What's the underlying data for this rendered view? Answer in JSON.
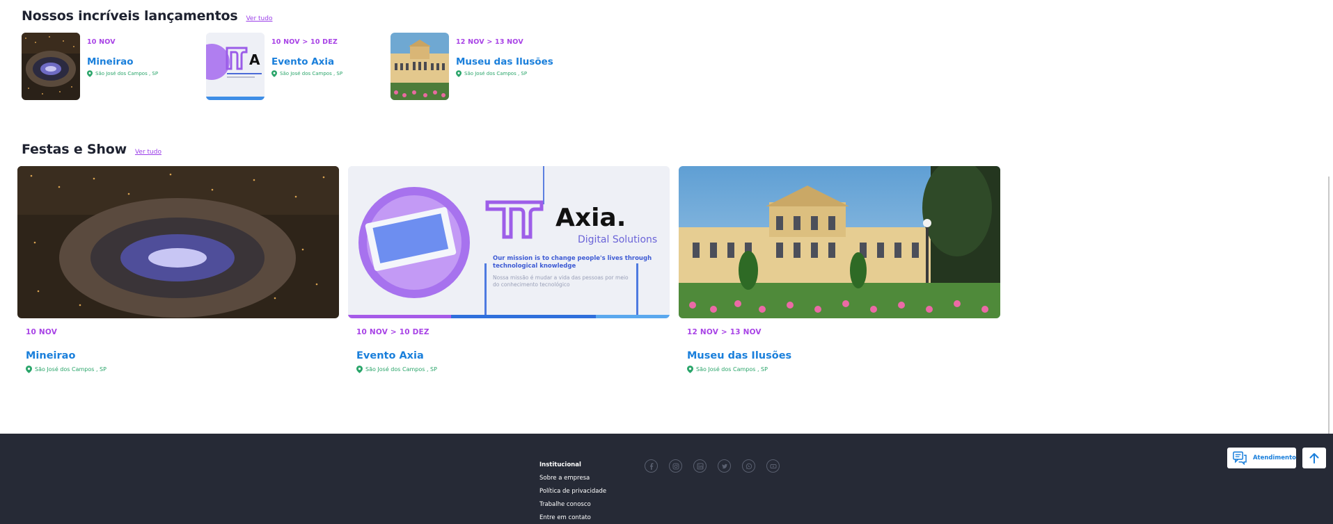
{
  "launches": {
    "title": "Nossos incríveis lançamentos",
    "see_all": "Ver tudo",
    "items": [
      {
        "date": "10 NOV",
        "name": "Mineirao",
        "location": "São José dos Campos , SP"
      },
      {
        "date": "10 NOV > 10 DEZ",
        "name": "Evento Axia",
        "location": "São José dos Campos , SP"
      },
      {
        "date": "12 NOV > 13 NOV",
        "name": "Museu das Ilusões",
        "location": "São José dos Campos , SP"
      }
    ]
  },
  "parties": {
    "title": "Festas e Show",
    "see_all": "Ver tudo",
    "items": [
      {
        "date": "10 NOV",
        "name": "Mineirao",
        "location": "São José dos Campos , SP"
      },
      {
        "date": "10 NOV > 10 DEZ",
        "name": "Evento Axia",
        "location": "São José dos Campos , SP"
      },
      {
        "date": "12 NOV > 13 NOV",
        "name": "Museu das Ilusões",
        "location": "São José dos Campos , SP"
      }
    ]
  },
  "axia_art": {
    "brand": "Axia.",
    "tagline": "Digital Solutions",
    "mission": "Our mission is to change people's lives through technological knowledge",
    "mission_pt": "Nossa missão é mudar a vida das pessoas por meio do conhecimento tecnológico"
  },
  "footer": {
    "heading": "Institucional",
    "links": [
      "Sobre a empresa",
      "Política de privacidade",
      "Trabalhe conosco",
      "Entre em contato"
    ],
    "socials": [
      "facebook-icon",
      "instagram-icon",
      "linkedin-icon",
      "twitter-icon",
      "whatsapp-icon",
      "youtube-icon"
    ],
    "attend_label": "Atendimento"
  },
  "colors": {
    "accent_purple": "#a843e6",
    "accent_blue": "#1a7fdb",
    "location_green": "#2aa56a",
    "footer_bg": "#262a36"
  }
}
